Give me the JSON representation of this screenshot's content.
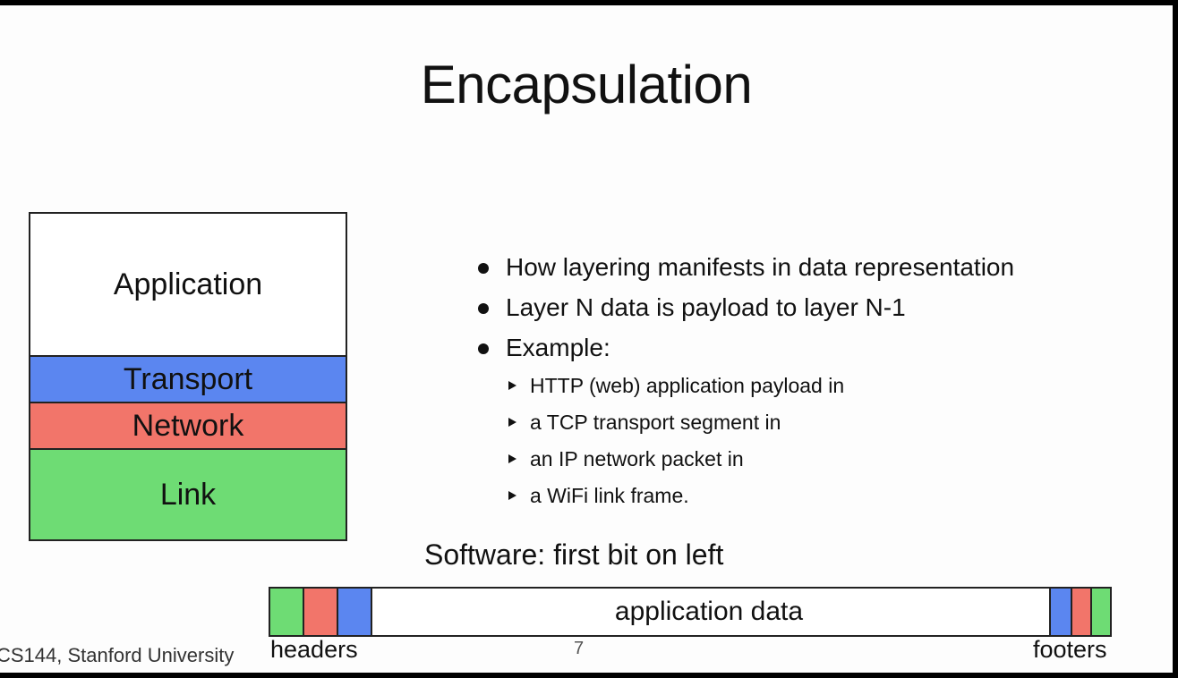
{
  "title": "Encapsulation",
  "layer_stack": [
    {
      "name": "Application",
      "color": "#ffffff"
    },
    {
      "name": "Transport",
      "color": "#5b86f0"
    },
    {
      "name": "Network",
      "color": "#f2756a"
    },
    {
      "name": "Link",
      "color": "#6edc74"
    }
  ],
  "bullets": [
    "How layering manifests in data representation",
    "Layer N data is payload to layer N-1",
    "Example:"
  ],
  "sub_bullets": [
    "HTTP (web) application payload in",
    "a TCP transport segment in",
    "an IP network packet in",
    "a WiFi link frame."
  ],
  "packet": {
    "caption": "Software: first bit on left",
    "data_label": "application data",
    "headers_label": "headers",
    "footers_label": "footers",
    "header_colors": [
      "#6edc74",
      "#f2756a",
      "#5b86f0"
    ],
    "footer_colors": [
      "#5b86f0",
      "#f2756a",
      "#6edc74"
    ]
  },
  "footer": {
    "course": "CS144, Stanford University",
    "page": "7"
  }
}
